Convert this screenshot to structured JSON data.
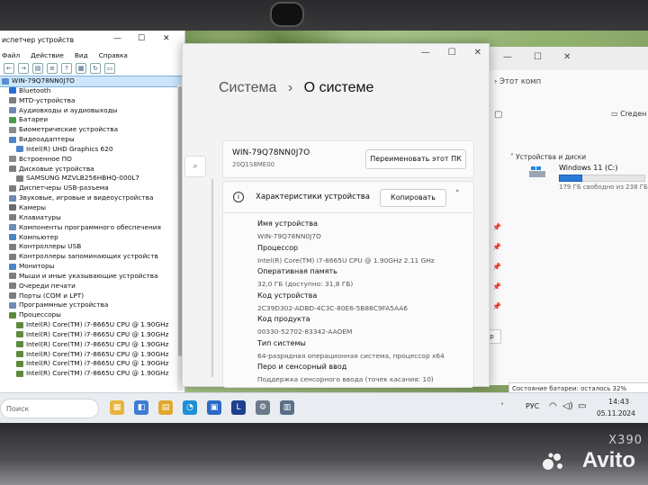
{
  "device_manager": {
    "title": "испетчер устройств",
    "menu": [
      "Файл",
      "Действие",
      "Вид",
      "Справка"
    ],
    "tree": [
      {
        "label": "WIN-79Q78NN0J7O",
        "level": 0,
        "selected": true,
        "color": "#5a8fd0"
      },
      {
        "label": "Bluetooth",
        "level": 1,
        "color": "#2a6fd6"
      },
      {
        "label": "MTD-устройства",
        "level": 1,
        "color": "#7d7d7d"
      },
      {
        "label": "Аудиовходы и аудиовыходы",
        "level": 1,
        "color": "#6c8cb0"
      },
      {
        "label": "Батареи",
        "level": 1,
        "color": "#4d9a4d"
      },
      {
        "label": "Биометрические устройства",
        "level": 1,
        "color": "#8a8a8a"
      },
      {
        "label": "Видеоадаптеры",
        "level": 1,
        "color": "#4c86c8"
      },
      {
        "label": "Intel(R) UHD Graphics 620",
        "level": 2,
        "color": "#4c86c8"
      },
      {
        "label": "Встроенное ПО",
        "level": 1,
        "color": "#8a8a8a"
      },
      {
        "label": "Дисковые устройства",
        "level": 1,
        "color": "#7d7d7d"
      },
      {
        "label": "SAMSUNG MZVLB256HBHQ-000L7",
        "level": 2,
        "color": "#7d7d7d"
      },
      {
        "label": "Диспетчеры USB-разъема",
        "level": 1,
        "color": "#7d7d7d"
      },
      {
        "label": "Звуковые, игровые и видеоустройства",
        "level": 1,
        "color": "#6c8cb0"
      },
      {
        "label": "Камеры",
        "level": 1,
        "color": "#6d6d6d"
      },
      {
        "label": "Клавиатуры",
        "level": 1,
        "color": "#7d7d7d"
      },
      {
        "label": "Компоненты программного обеспечения",
        "level": 1,
        "color": "#6c8cb0"
      },
      {
        "label": "Компьютер",
        "level": 1,
        "color": "#4c86c8"
      },
      {
        "label": "Контроллеры USB",
        "level": 1,
        "color": "#7d7d7d"
      },
      {
        "label": "Контроллеры запоминающих устройств",
        "level": 1,
        "color": "#7d7d7d"
      },
      {
        "label": "Мониторы",
        "level": 1,
        "color": "#4c86c8"
      },
      {
        "label": "Мыши и иные указывающие устройства",
        "level": 1,
        "color": "#7d7d7d"
      },
      {
        "label": "Очереди печати",
        "level": 1,
        "color": "#7d7d7d"
      },
      {
        "label": "Порты (COM и LPT)",
        "level": 1,
        "color": "#7d7d7d"
      },
      {
        "label": "Программные устройства",
        "level": 1,
        "color": "#6c8cb0"
      },
      {
        "label": "Процессоры",
        "level": 1,
        "color": "#5e8a3e"
      },
      {
        "label": "Intel(R) Core(TM) i7-8665U CPU @ 1.90GHz",
        "level": 2,
        "color": "#5e8a3e"
      },
      {
        "label": "Intel(R) Core(TM) i7-8665U CPU @ 1.90GHz",
        "level": 2,
        "color": "#5e8a3e"
      },
      {
        "label": "Intel(R) Core(TM) i7-8665U CPU @ 1.90GHz",
        "level": 2,
        "color": "#5e8a3e"
      },
      {
        "label": "Intel(R) Core(TM) i7-8665U CPU @ 1.90GHz",
        "level": 2,
        "color": "#5e8a3e"
      },
      {
        "label": "Intel(R) Core(TM) i7-8665U CPU @ 1.90GHz",
        "level": 2,
        "color": "#5e8a3e"
      },
      {
        "label": "Intel(R) Core(TM) i7-8665U CPU @ 1.90GHz",
        "level": 2,
        "color": "#5e8a3e"
      }
    ]
  },
  "settings": {
    "breadcrumb_parent": "Система",
    "breadcrumb_separator": "›",
    "breadcrumb_current": "О системе",
    "pc_name": "WIN-79Q78NN0J7O",
    "pc_model": "20Q1S8ME00",
    "rename_button": "Переименовать этот ПК",
    "spec_title": "Характеристики устройства",
    "copy_button": "Копировать",
    "specs": [
      {
        "label": "Имя устройства",
        "value": "WIN-79Q78NN0J7O"
      },
      {
        "label": "Процессор",
        "value": "Intel(R) Core(TM) i7-8665U CPU @ 1.90GHz   2.11 GHz"
      },
      {
        "label": "Оперативная память",
        "value": "32,0 ГБ (доступно: 31,8 ГБ)"
      },
      {
        "label": "Код устройства",
        "value": "2C39D302-ADBD-4C3C-80E6-5B88C9FA5AA6"
      },
      {
        "label": "Код продукта",
        "value": "00330-52702-83342-AAOEM"
      },
      {
        "label": "Тип системы",
        "value": "64-разрядная операционная система, процессор x64"
      },
      {
        "label": "Перо и сенсорный ввод",
        "value": "Поддержка сенсорного ввода (точек касания: 10)"
      }
    ]
  },
  "explorer": {
    "address": "Этот комп",
    "new_label": "Creден",
    "section_header": "Устройства и диски",
    "drive_name": "Windows 11 (C:)",
    "drive_free": "179 ГБ свободно из 238 ГБ",
    "drive_used_fraction": 0.25,
    "partial_button": "ер"
  },
  "battery_tooltip": "Состояние батареи: осталось 32% заряда 1h 1min",
  "taskbar": {
    "search_placeholder": "Поиск",
    "apps": [
      {
        "name": "explorer-app",
        "glyph": "▦",
        "color": "#e8b53c"
      },
      {
        "name": "taskview-app",
        "glyph": "◧",
        "color": "#3b7bd4"
      },
      {
        "name": "folder-app",
        "glyph": "▤",
        "color": "#e0a82e"
      },
      {
        "name": "edge-app",
        "glyph": "◔",
        "color": "#1f8fd6"
      },
      {
        "name": "store-app",
        "glyph": "▣",
        "color": "#2d6ac7"
      },
      {
        "name": "app-l",
        "glyph": "L",
        "color": "#1d3f8f"
      },
      {
        "name": "settings-app",
        "glyph": "⚙",
        "color": "#6b7b8c"
      },
      {
        "name": "devmgr-app",
        "glyph": "▥",
        "color": "#5a6f88"
      }
    ],
    "lang": "РУС",
    "time": "14:43",
    "date": "05.11.2024"
  },
  "device_label": "X390",
  "watermark": "Avito"
}
